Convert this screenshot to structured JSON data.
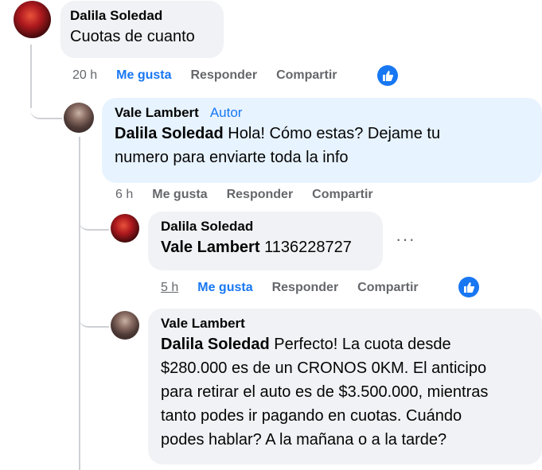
{
  "comments": [
    {
      "author": "Dalila Soledad",
      "text": "Cuotas de cuanto",
      "time": "20 h",
      "like": "Me gusta",
      "reply": "Responder",
      "share": "Compartir"
    },
    {
      "author": "Vale Lambert",
      "badge": "Autor",
      "mention": "Dalila Soledad",
      "text_line1": " Hola! Cómo estas? Dejame tu",
      "text_line2": "numero para enviarte toda la info",
      "time": "6 h",
      "like": "Me gusta",
      "reply": "Responder",
      "share": "Compartir"
    },
    {
      "author": "Dalila Soledad",
      "mention": "Vale Lambert",
      "text": " 1136228727",
      "time": "5 h",
      "like": "Me gusta",
      "reply": "Responder",
      "share": "Compartir",
      "more": "···"
    },
    {
      "author": "Vale Lambert",
      "mention": "Dalila Soledad",
      "text_line1": " Perfecto! La cuota desde",
      "text_line2": "$280.000 es de un CRONOS 0KM. El anticipo",
      "text_line3": "para retirar el auto es de $3.500.000, mientras",
      "text_line4": "tanto podes ir pagando en cuotas. Cuándo",
      "text_line5": "podes hablar? A la mañana o a la tarde?"
    }
  ],
  "colors": {
    "accent": "#1877f2",
    "bubble": "#f0f2f5",
    "author_bubble": "#e7f3ff",
    "meta": "#65676b"
  }
}
